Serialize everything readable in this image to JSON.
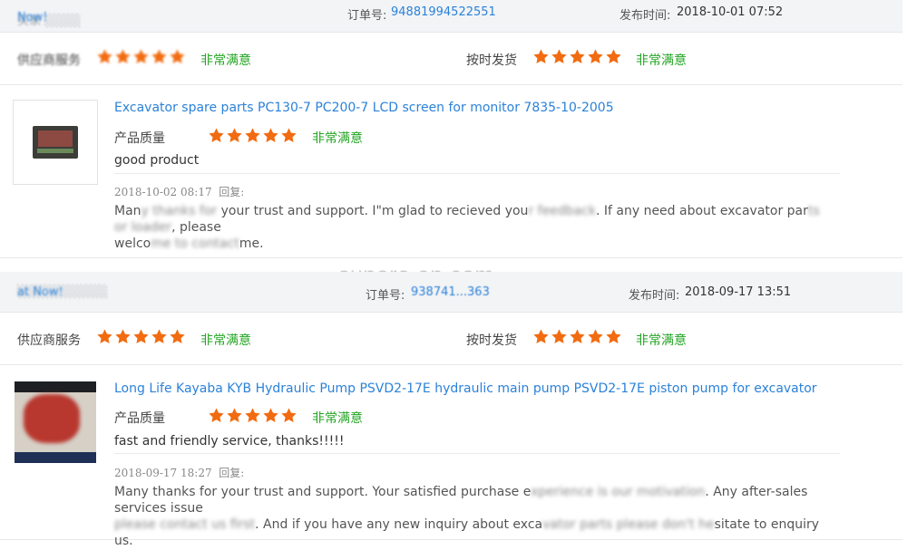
{
  "colors": {
    "link": "#2b82d9",
    "satisfied": "#22a522",
    "star": "#f26b10",
    "header_bg": "#f3f4f6"
  },
  "watermark": "sunore.en.com",
  "reviews": [
    {
      "buyer": "买家 ░░░░ ",
      "buyer_now": "Now!",
      "order_label": "订单号:",
      "order_no": "94881994522551",
      "pub_label": "发布时间:",
      "pub_time": "2018-10-01 07:52",
      "supplier_label": "供应商服务",
      "supplier_sat": "非常满意",
      "shipping_label": "按时发货",
      "shipping_stars": 5,
      "shipping_sat": "非常满意",
      "product_title": "Excavator spare parts PC130-7 PC200-7 LCD screen for monitor 7835-10-2005",
      "quality_label": "产品质量",
      "quality_stars": 5,
      "quality_sat": "非常满意",
      "comment": "good product",
      "reply_date": "2018-10-02 08:17",
      "reply_label": "回复:",
      "reply_line1_a": "Man",
      "reply_line1_blur1": "y thanks for",
      "reply_line1_b": " your trust and support. I\"m glad to recieved you",
      "reply_line1_blur2": "r feedback",
      "reply_line1_c": ". If any need about excavator par",
      "reply_line1_blur3": "ts or loader",
      "reply_line1_d": ", please",
      "reply_line2_a": "welco",
      "reply_line2_blur": "me to contact",
      "reply_line2_b": "me."
    },
    {
      "buyer": "░░░░░░░░░░ ",
      "buyer_now": "at Now!",
      "order_label": "订单号:",
      "order_no": "938741...363",
      "pub_label": "发布时间:",
      "pub_time": "2018-09-17 13:51",
      "supplier_label": "供应商服务",
      "supplier_sat": "非常满意",
      "shipping_label": "按时发货",
      "shipping_stars": 5,
      "shipping_sat": "非常满意",
      "product_title": "Long Life Kayaba KYB Hydraulic Pump PSVD2-17E hydraulic main pump PSVD2-17E piston pump for excavator",
      "quality_label": "产品质量",
      "quality_stars": 5,
      "quality_sat": "非常满意",
      "comment": "fast and friendly service, thanks!!!!!",
      "reply_date": "2018-09-17 18:27",
      "reply_label": "回复:",
      "reply_line1_a": "Many thanks for your trust and support. Your satisfied purchase e",
      "reply_line1_blur1": "xperience is our motivation",
      "reply_line1_b": ". Any after-sales services issue",
      "reply_line2_blur1": "please contact us first",
      "reply_line2_a": ". And if you have any new inquiry about exca",
      "reply_line2_blur2": "vator parts please don't he",
      "reply_line2_b": "sitate to enquiry us."
    }
  ]
}
